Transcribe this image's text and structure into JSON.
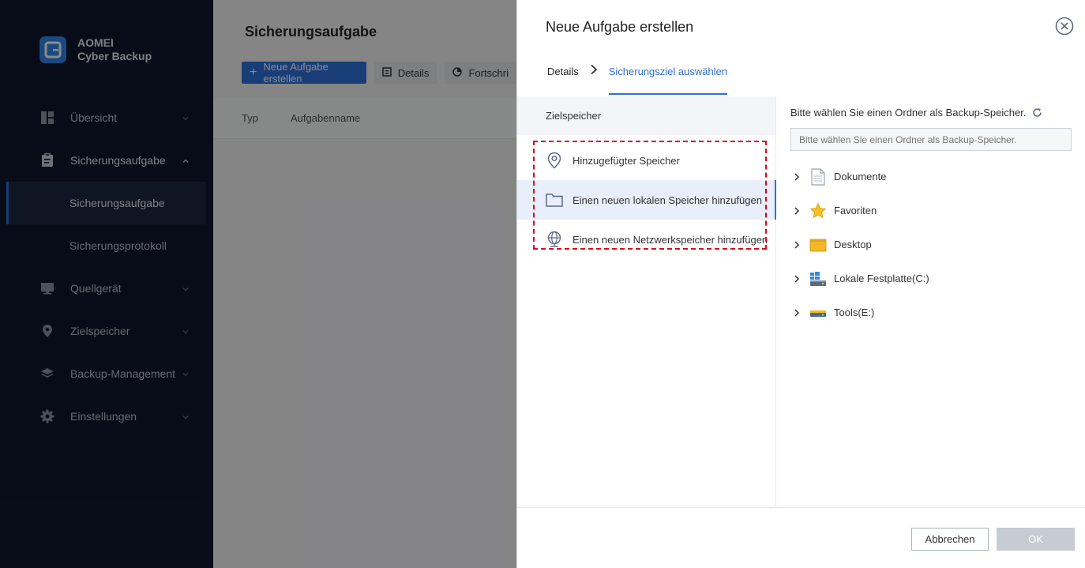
{
  "app": {
    "name_line1": "AOMEI",
    "name_line2": "Cyber Backup"
  },
  "sidebar": {
    "items": [
      {
        "label": "Übersicht",
        "icon": "dashboard-icon"
      },
      {
        "label": "Sicherungsaufgabe",
        "icon": "clipboard-icon",
        "expanded": true
      },
      {
        "label": "Sicherungsaufgabe",
        "sub": true,
        "active": true
      },
      {
        "label": "Sicherungsprotokoll",
        "sub": true
      },
      {
        "label": "Quellgerät",
        "icon": "monitor-icon"
      },
      {
        "label": "Zielspeicher",
        "icon": "location-pin-icon"
      },
      {
        "label": "Backup-Management",
        "icon": "layers-icon"
      },
      {
        "label": "Einstellungen",
        "icon": "gear-icon"
      }
    ]
  },
  "main": {
    "title": "Sicherungsaufgabe",
    "toolbar": {
      "new_task": "Neue Aufgabe erstellen",
      "details": "Details",
      "progress": "Fortschri"
    },
    "columns": {
      "type": "Typ",
      "name": "Aufgabenname"
    }
  },
  "dialog": {
    "title": "Neue Aufgabe erstellen",
    "steps": {
      "step1": "Details",
      "step2": "Sicherungsziel auswählen"
    },
    "target_header": "Zielspeicher",
    "options": [
      {
        "label": "Hinzugefügter Speicher",
        "icon": "location-pin-icon"
      },
      {
        "label": "Einen neuen lokalen Speicher hinzufügen",
        "icon": "folder-icon",
        "selected": true
      },
      {
        "label": "Einen neuen Netzwerkspeicher hinzufügen",
        "icon": "network-globe-icon"
      }
    ],
    "folder_prompt": "Bitte wählen Sie einen Ordner als Backup-Speicher.",
    "folder_input": {
      "value": "",
      "placeholder": "Bitte wählen Sie einen Ordner als Backup-Speicher."
    },
    "tree": [
      {
        "label": "Dokumente",
        "icon": "document-icon"
      },
      {
        "label": "Favoriten",
        "icon": "star-icon"
      },
      {
        "label": "Desktop",
        "icon": "desktop-folder-icon"
      },
      {
        "label": "Lokale Festplatte(C:)",
        "icon": "windows-drive-icon"
      },
      {
        "label": "Tools(E:)",
        "icon": "drive-icon"
      }
    ],
    "buttons": {
      "cancel": "Abbrechen",
      "ok": "OK"
    }
  },
  "colors": {
    "accent": "#2f6fd8",
    "sidebar_bg": "#0f172e",
    "highlight_box": "#e0001a"
  }
}
